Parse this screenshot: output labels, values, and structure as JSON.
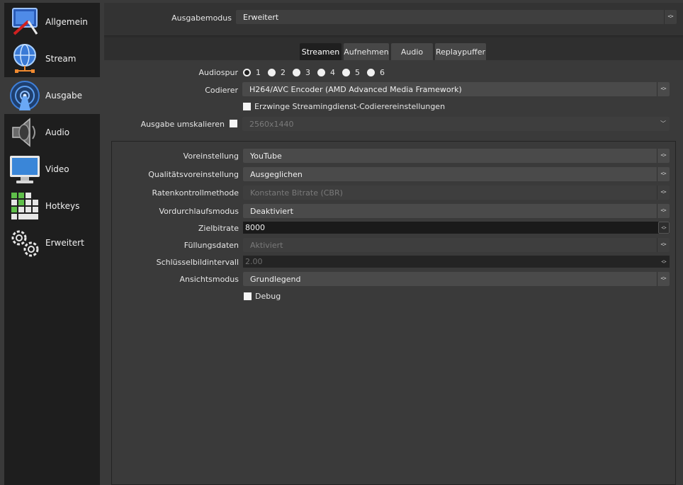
{
  "sidebar": {
    "items": [
      {
        "label": "Allgemein",
        "icon": "general-settings-icon"
      },
      {
        "label": "Stream",
        "icon": "globe-network-icon"
      },
      {
        "label": "Ausgabe",
        "icon": "broadcast-antenna-icon"
      },
      {
        "label": "Audio",
        "icon": "speaker-icon"
      },
      {
        "label": "Video",
        "icon": "monitor-icon"
      },
      {
        "label": "Hotkeys",
        "icon": "keyboard-icon"
      },
      {
        "label": "Erweitert",
        "icon": "gears-icon"
      }
    ],
    "active_index": 2
  },
  "output_mode": {
    "label": "Ausgabemodus",
    "value": "Erweitert"
  },
  "tabs": [
    {
      "label": "Streamen",
      "active": true
    },
    {
      "label": "Aufnehmen",
      "active": false
    },
    {
      "label": "Audio",
      "active": false
    },
    {
      "label": "Replaypuffer",
      "active": false
    }
  ],
  "audio_track": {
    "label": "Audiospur",
    "options": [
      "1",
      "2",
      "3",
      "4",
      "5",
      "6"
    ],
    "selected": "1"
  },
  "encoder": {
    "label": "Codierer",
    "value": "H264/AVC Encoder (AMD Advanced Media Framework)"
  },
  "enforce_streaming": {
    "label": "Erzwinge Streamingdienst-Codierereinstellungen",
    "checked": false
  },
  "rescale": {
    "label": "Ausgabe umskalieren",
    "checked": false,
    "value": "2560x1440"
  },
  "encoder_settings": {
    "preset": {
      "label": "Voreinstellung",
      "value": "YouTube"
    },
    "quality_preset": {
      "label": "Qualitätsvoreinstellung",
      "value": "Ausgeglichen"
    },
    "rate_control": {
      "label": "Ratenkontrollmethode",
      "value": "Konstante Bitrate (CBR)"
    },
    "pre_pass": {
      "label": "Vordurchlaufsmodus",
      "value": "Deaktiviert"
    },
    "target_bitrate": {
      "label": "Zielbitrate",
      "value": "8000"
    },
    "filler_data": {
      "label": "Füllungsdaten",
      "value": "Aktiviert"
    },
    "keyframe_interval": {
      "label": "Schlüsselbildintervall",
      "value": "2.00"
    },
    "view_mode": {
      "label": "Ansichtsmodus",
      "value": "Grundlegend"
    },
    "debug": {
      "label": "Debug",
      "checked": false
    }
  },
  "colors": {
    "background": "#3a3a3a",
    "sidebar": "#1e1e1e",
    "field": "#4a4a4a",
    "active_tab": "#1f1f1f"
  }
}
